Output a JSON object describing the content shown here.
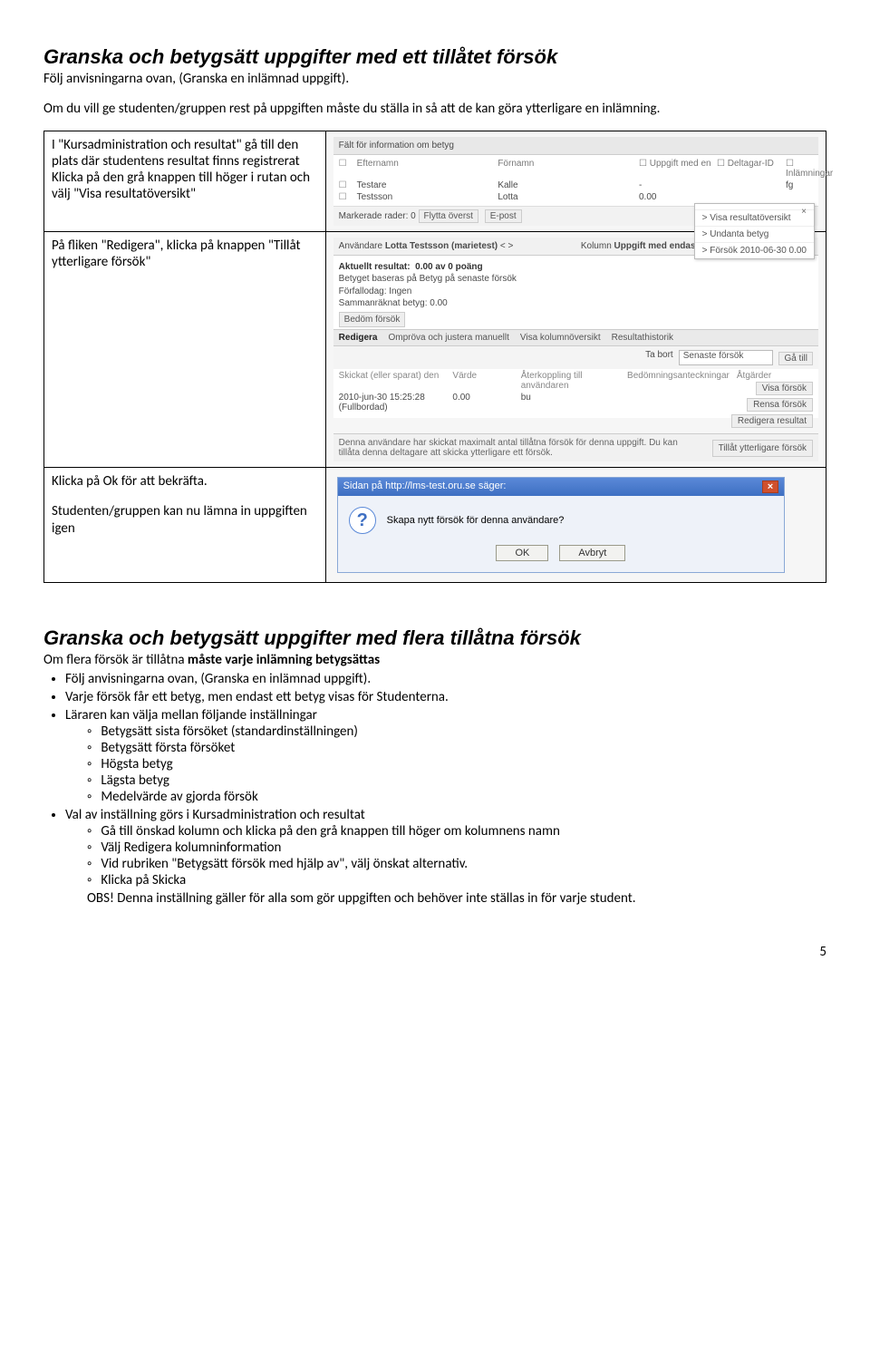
{
  "section1": {
    "heading": "Granska och betygsätt uppgifter med ett tillåtet försök",
    "p1": "Följ anvisningarna ovan, (Granska en inlämnad uppgift).",
    "p2": "Om du vill ge studenten/gruppen rest på uppgiften måste du ställa in så att de kan göra ytterligare en inlämning."
  },
  "rows": {
    "r1_text": "I \"Kursadministration och resultat\" gå till den plats där studentens resultat finns registrerat\nKlicka på den grå knappen till höger i rutan och välj \"Visa resultatöversikt\"",
    "r2_text": "På fliken \"Redigera\", klicka på knappen \"Tillåt ytterligare försök\"",
    "r3a": "Klicka på Ok för att bekräfta.",
    "r3b": "Studenten/gruppen kan nu lämna in uppgiften igen"
  },
  "shot1": {
    "infoField": "Fält för information om betyg",
    "col_ck": "",
    "col_lastname": "Efternamn",
    "col_firstname": "Förnamn",
    "col_task": "Uppgift med en",
    "col_partid": "Deltagar-ID",
    "col_submissions": "Inlämningar",
    "r1_last": "Testare",
    "r1_first": "Kalle",
    "r1_val": "-",
    "r1_id": "",
    "r1_sub": "fg",
    "r2_last": "Testsson",
    "r2_first": "Lotta",
    "r2_val": "0.00",
    "r2_id": "",
    "r2_sub": "",
    "marked": "Markerade rader: 0",
    "btn_moveTop": "Flytta överst",
    "btn_email": "E-post",
    "menu_view": "> Visa resultatöversikt",
    "menu_undanta": "> Undanta betyg",
    "menu_attempt": "> Försök 2010-06-30 0.00",
    "menu_close": "×"
  },
  "shot2": {
    "userLabel": "Användare",
    "userValue": "Lotta Testsson (marietest)",
    "nav": "< >",
    "colLabel": "Kolumn",
    "colValue": "Uppgift med endast en inlämning (Uppgift)",
    "currLabel": "Aktuellt resultat:",
    "currValue": "0.00 av 0 poäng",
    "line1": "Betyget baseras på Betyg på senaste försök",
    "line2": "Förfallodag: Ingen",
    "line3": "Sammanräknat betyg: 0.00",
    "btn_grade": "Bedöm försök",
    "tab1": "Redigera",
    "tab2": "Ompröva och justera manuellt",
    "tab3": "Visa kolumnöversikt",
    "tab4": "Resultathistorik",
    "takebort": "Ta bort",
    "senaste": "Senaste försök",
    "go": "Gå till",
    "th1": "Skickat (eller sparat) den",
    "th2": "Värde",
    "th3": "Återkoppling till användaren",
    "th4": "Bedömningsanteckningar",
    "th5": "Åtgärder",
    "td1": "2010-jun-30 15:25:28\n(Fullbordad)",
    "td2": "0.00",
    "td3": "bu",
    "act1": "Visa försök",
    "act2": "Rensa försök",
    "act3": "Redigera resultat",
    "note": "Denna användare har skickat maximalt antal tillåtna försök för denna uppgift. Du kan tillåta denna deltagare att skicka ytterligare ett försök.",
    "allowBtn": "Tillåt ytterligare försök"
  },
  "dialog": {
    "title": "Sidan på http://lms-test.oru.se säger:",
    "msg": "Skapa nytt försök för denna användare?",
    "ok": "OK",
    "cancel": "Avbryt"
  },
  "section2": {
    "heading": "Granska och betygsätt uppgifter med flera tillåtna försök",
    "lead_a": "Om flera försök är tillåtna ",
    "lead_b": "måste varje inlämning betygsättas",
    "b1": "Följ anvisningarna ovan, (Granska en inlämnad uppgift).",
    "b2": "Varje försök får ett betyg, men endast ett betyg visas för Studenterna.",
    "b3": "Läraren kan välja mellan följande inställningar",
    "b3s1": "Betygsätt sista försöket (standardinställningen)",
    "b3s2": "Betygsätt första försöket",
    "b3s3": "Högsta betyg",
    "b3s4": "Lägsta betyg",
    "b3s5": "Medelvärde av gjorda försök",
    "b4": "Val av inställning görs i Kursadministration och resultat",
    "b4s1": "Gå till önskad kolumn och klicka på den grå knappen till höger om kolumnens namn",
    "b4s2": "Välj Redigera kolumninformation",
    "b4s3": "Vid rubriken \"Betygsätt försök med hjälp av\", välj önskat alternativ.",
    "b4s4": "Klicka på Skicka",
    "obs": "OBS! Denna inställning gäller för alla som gör uppgiften och behöver inte ställas in för varje student."
  },
  "pagenum": "5"
}
